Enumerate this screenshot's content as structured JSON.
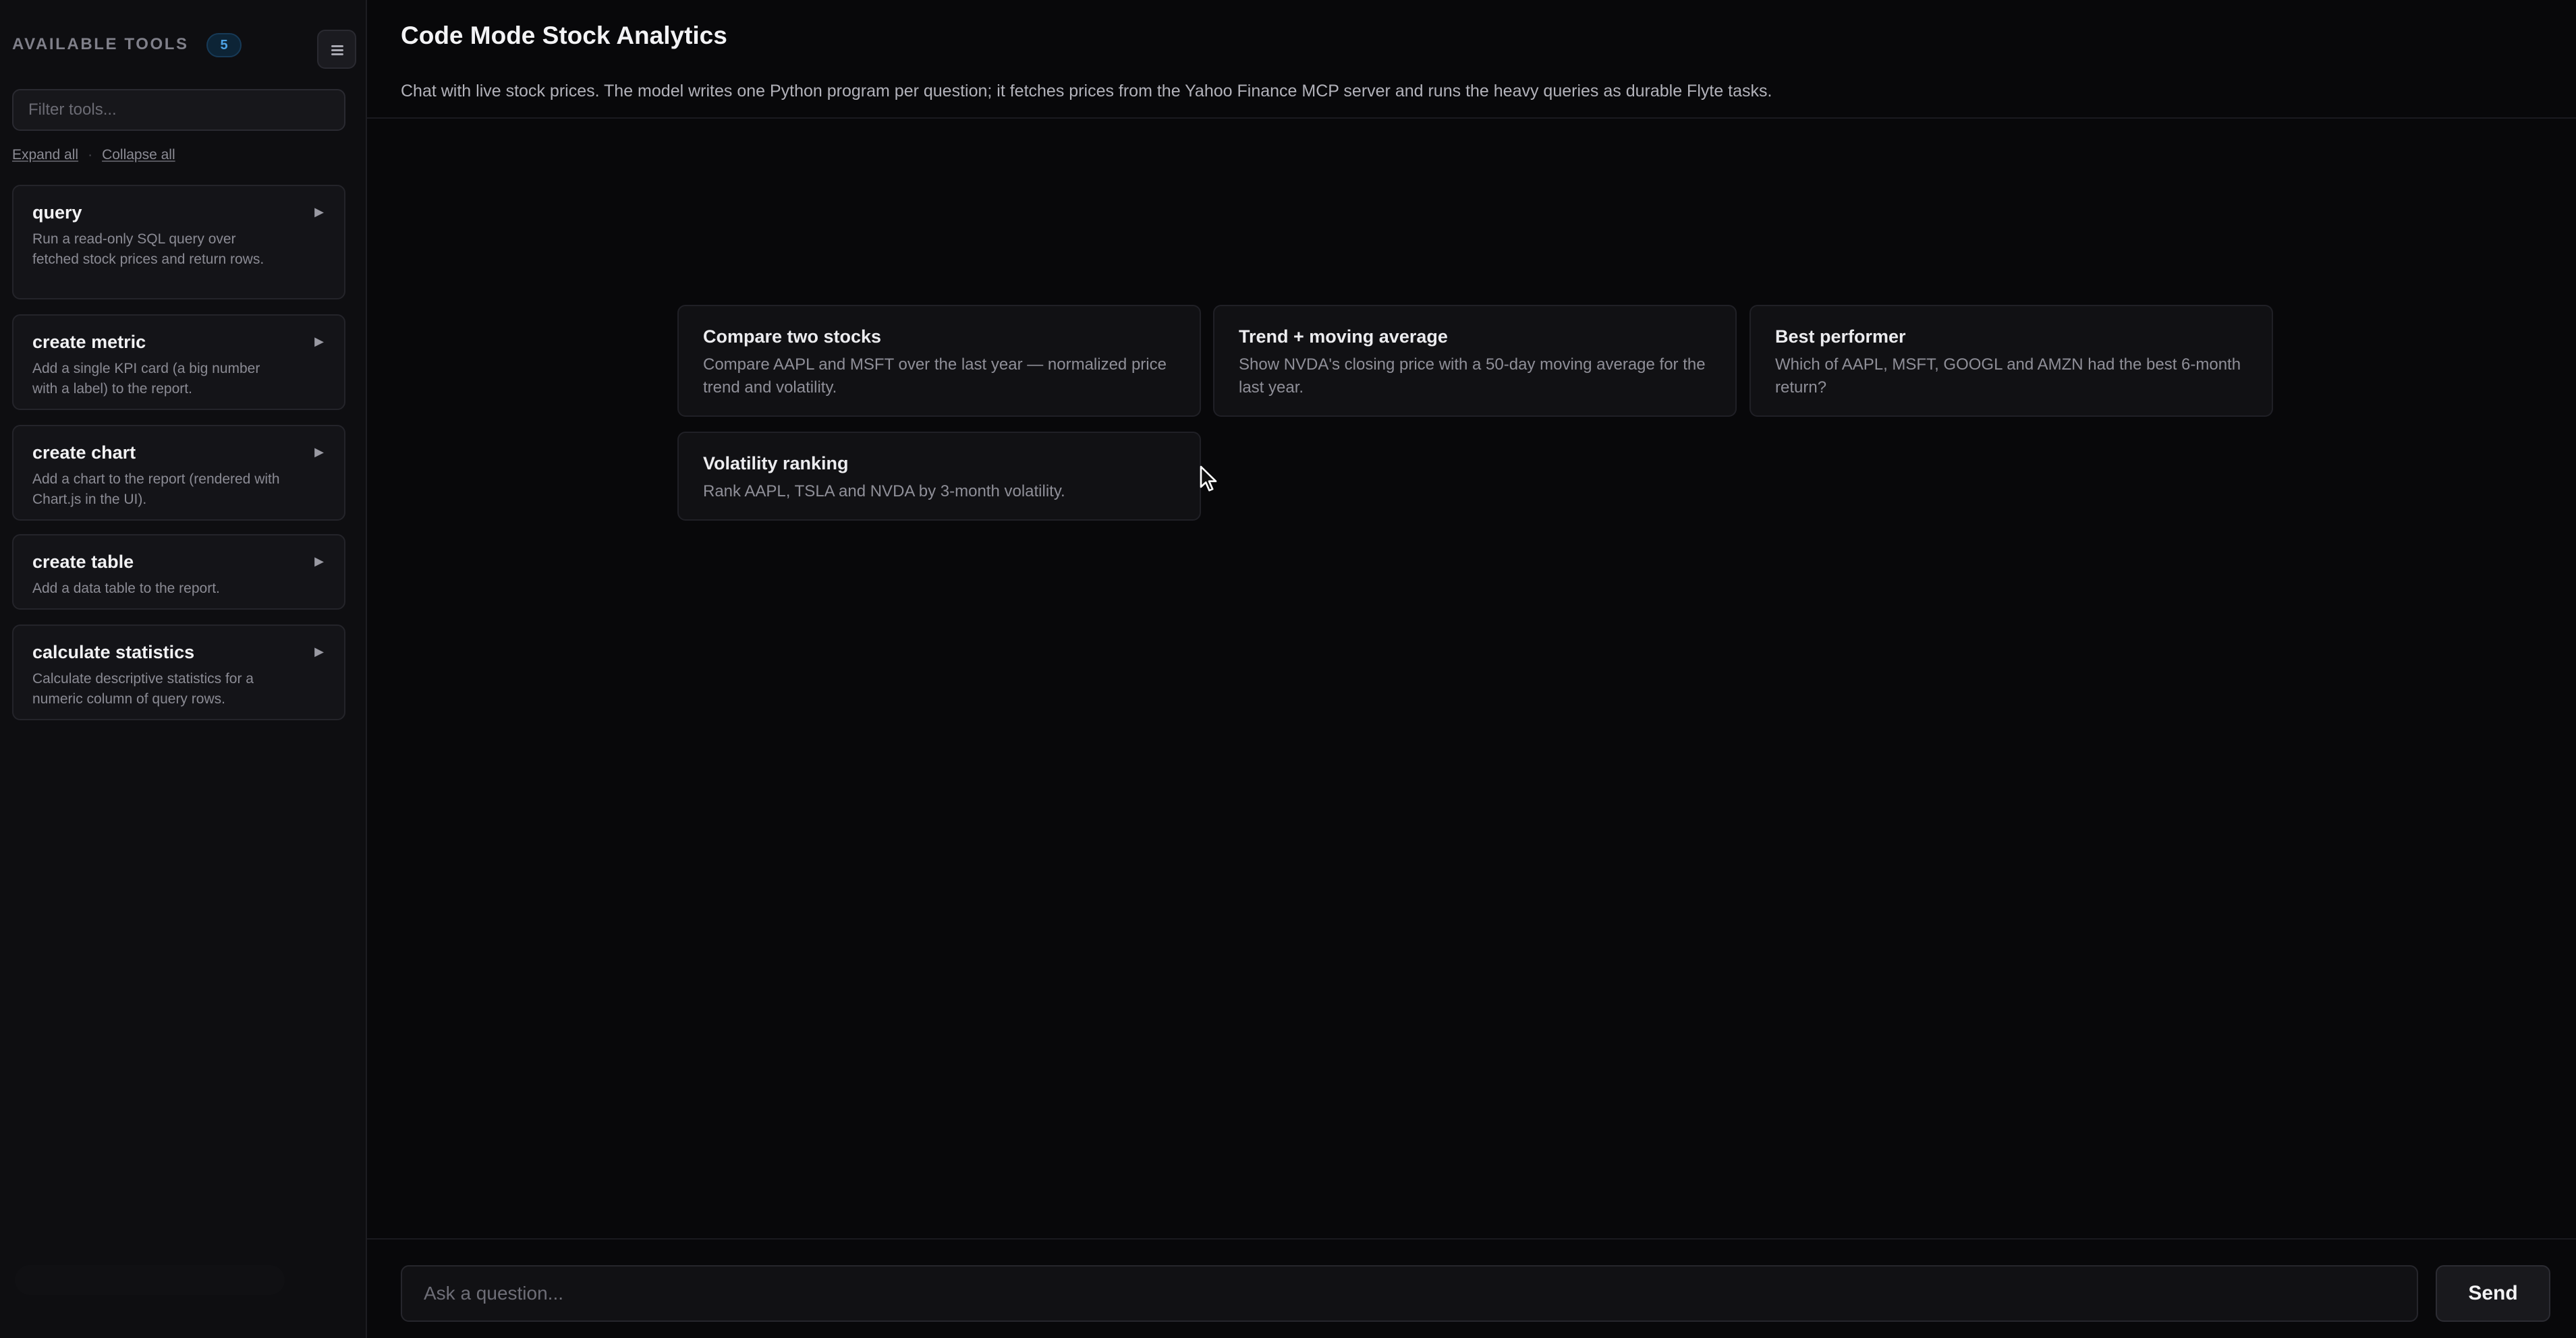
{
  "sidebar": {
    "title": "AVAILABLE TOOLS",
    "count": "5",
    "toggle_icon": "menu-icon",
    "filter_placeholder": "Filter tools...",
    "expand_all": "Expand all",
    "separator": "·",
    "collapse_all": "Collapse all",
    "tools": [
      {
        "name": "query",
        "description": "Run a read-only SQL query over fetched stock prices and return rows."
      },
      {
        "name": "create metric",
        "description": "Add a single KPI card (a big number with a label) to the report."
      },
      {
        "name": "create chart",
        "description": "Add a chart to the report (rendered with Chart.js in the UI)."
      },
      {
        "name": "create table",
        "description": "Add a data table to the report."
      },
      {
        "name": "calculate statistics",
        "description": "Calculate descriptive statistics for a numeric column of query rows."
      }
    ],
    "expand_icon": "▶"
  },
  "header": {
    "title": "Code Mode Stock Analytics",
    "subtitle": "Chat with live stock prices. The model writes one Python program per question; it fetches prices from the Yahoo Finance MCP server and runs the heavy queries as durable Flyte tasks."
  },
  "prompts": [
    {
      "title": "Compare two stocks",
      "description": "Compare AAPL and MSFT over the last year — normalized price trend and volatility."
    },
    {
      "title": "Trend + moving average",
      "description": "Show NVDA's closing price with a 50-day moving average for the last year."
    },
    {
      "title": "Best performer",
      "description": "Which of AAPL, MSFT, GOOGL and AMZN had the best 6-month return?"
    },
    {
      "title": "Volatility ranking",
      "description": "Rank AAPL, TSLA and NVDA by 3-month volatility."
    }
  ],
  "composer": {
    "placeholder": "Ask a question...",
    "send_label": "Send"
  },
  "colors": {
    "background": "#08080a",
    "sidebar": "#0e0e11",
    "card": "#111114",
    "badge_text": "#4ea3e6"
  }
}
